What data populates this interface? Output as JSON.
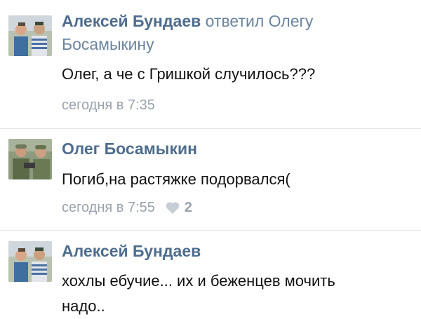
{
  "comments": [
    {
      "author": "Алексей Бундаев",
      "reply_note": "ответил Олегу Босамыкину",
      "text": "Олег, а че с Гришкой случилось???",
      "time": "сегодня в 7:35",
      "avatar_icon": "user-photo-icon"
    },
    {
      "author": "Олег Босамыкин",
      "text": "Погиб,на растяжке подорвался(",
      "time": "сегодня в 7:55",
      "likes": "2",
      "like_icon": "heart-icon",
      "avatar_icon": "user-photo-icon"
    },
    {
      "author": "Алексей Бундаев",
      "text": "хохлы ебучие... их и беженцев мочить надо..",
      "avatar_icon": "user-photo-icon"
    }
  ],
  "colors": {
    "author": "#4e6d8e",
    "meta": "#9aa3ad",
    "text": "#111111",
    "divider": "#e3e6ea"
  }
}
